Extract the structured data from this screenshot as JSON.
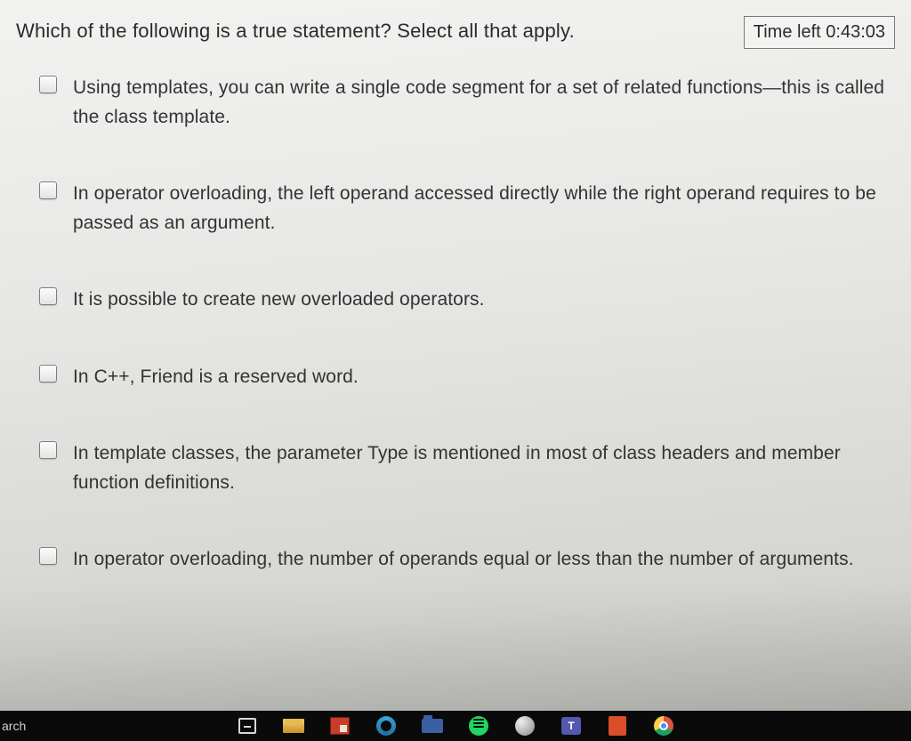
{
  "question": "Which of the following is a true statement? Select all that apply.",
  "timer": {
    "label": "Time left",
    "value": "0:43:03"
  },
  "options": [
    {
      "text": "Using templates, you can write a single code segment for a set of related functions—this is called the class template."
    },
    {
      "text": "In operator overloading, the left operand accessed directly while the right operand requires to be passed as an argument."
    },
    {
      "text": "It is possible to create new overloaded operators."
    },
    {
      "text": "In C++, Friend is a reserved word."
    },
    {
      "text": "In template classes, the parameter Type is mentioned in most of class headers and member function definitions."
    },
    {
      "text": "In operator overloading, the number of operands equal or less than the number of arguments."
    }
  ],
  "taskbar": {
    "search_fragment": "arch",
    "icons": [
      "task-view-icon",
      "mail-icon",
      "news-icon",
      "edge-icon",
      "file-explorer-icon",
      "spotify-icon",
      "sphere-icon",
      "teams-icon",
      "office-icon",
      "chrome-icon"
    ]
  }
}
